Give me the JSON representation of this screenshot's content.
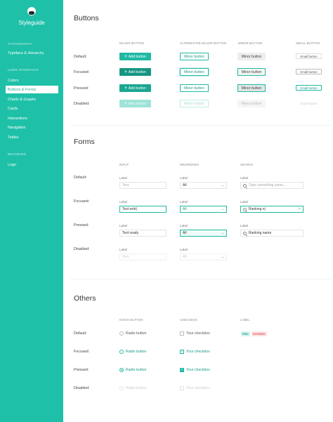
{
  "sidebar": {
    "brand": "Styleguide",
    "sections": [
      {
        "title": "TYPOGRAPHY",
        "items": [
          "Typeface & Hierarchy"
        ]
      },
      {
        "title": "USER INTERFACE",
        "items": [
          "Colors",
          "Buttons & Forms",
          "Charts & Graphs",
          "Cards",
          "Interactions",
          "Navigation",
          "Tables"
        ]
      },
      {
        "title": "BRANDING",
        "items": [
          "Logo"
        ]
      }
    ],
    "active_item": "Buttons & Forms"
  },
  "states": [
    "Default:",
    "Focused:",
    "Pressed:",
    "Disabled:"
  ],
  "buttons": {
    "title": "Buttons",
    "columns": [
      "MAJOR BUTTON",
      "ALTERNATIVE MAJOR BUTTON",
      "MINOR BUTTON",
      "SMALL BUTTON"
    ],
    "major_label": "Add button",
    "alt_label": "Minor button",
    "minor_label": "Minor button",
    "small_label": "Small button"
  },
  "forms": {
    "title": "Forms",
    "columns": [
      "INPUT",
      "DROPDOWN",
      "SEARCH"
    ],
    "field_label": "Label",
    "input": {
      "placeholder": "Text",
      "focused_value": "Text writi|",
      "pressed_value": "Text ready",
      "disabled_value": "Text"
    },
    "dropdown": {
      "value": "All"
    },
    "search": {
      "placeholder": "Type something name...",
      "focused_value": "Ranking n|",
      "pressed_value": "Ranking name"
    }
  },
  "others": {
    "title": "Others",
    "columns": [
      "RADIO BUTTON",
      "CHECKBOX",
      "LABEL"
    ],
    "radio_label": "Radio button",
    "checkbox_label": "Your checkbox",
    "tags": [
      "PRO",
      "EXPIRED"
    ]
  },
  "colors": {
    "accent": "#1fc0a8",
    "accent_dark": "#159582",
    "expired": "#e05b5b"
  }
}
